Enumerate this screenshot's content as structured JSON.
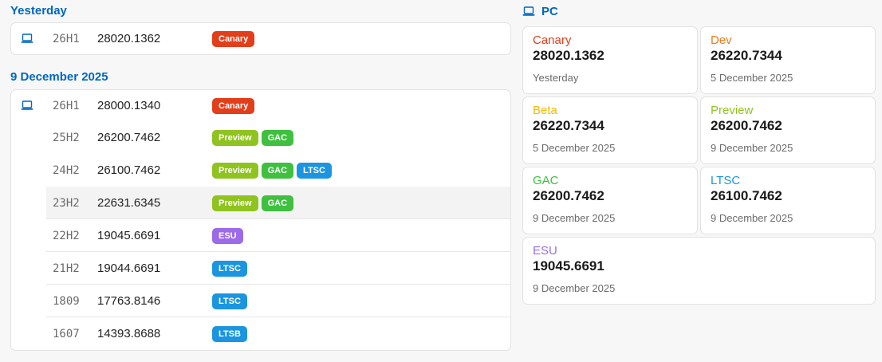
{
  "colors": {
    "accent": "#0067c0",
    "Canary": "#e23e1b",
    "Dev": "#ef7a1a",
    "Beta": "#f6b800",
    "Preview": "#8fc31f",
    "GAC": "#3fc03f",
    "LTSC": "#1b95e0",
    "LTSB": "#1b95e0",
    "ESU": "#9b6be8"
  },
  "feed": {
    "groups": [
      {
        "heading": "Yesterday",
        "rows": [
          {
            "icon": "laptop-icon",
            "version": "26H1",
            "build": "28020.1362",
            "badges": [
              "Canary"
            ]
          }
        ]
      },
      {
        "heading": "9 December 2025",
        "rows": [
          {
            "icon": "laptop-icon",
            "version": "26H1",
            "build": "28000.1340",
            "badges": [
              "Canary"
            ]
          },
          {
            "version": "25H2",
            "build": "26200.7462",
            "badges": [
              "Preview",
              "GAC"
            ]
          },
          {
            "version": "24H2",
            "build": "26100.7462",
            "badges": [
              "Preview",
              "GAC",
              "LTSC"
            ]
          },
          {
            "version": "23H2",
            "build": "22631.6345",
            "badges": [
              "Preview",
              "GAC"
            ],
            "highlight": true
          },
          {
            "version": "22H2",
            "build": "19045.6691",
            "badges": [
              "ESU"
            ]
          },
          {
            "version": "21H2",
            "build": "19044.6691",
            "badges": [
              "LTSC"
            ]
          },
          {
            "version": "1809",
            "build": "17763.8146",
            "badges": [
              "LTSC"
            ]
          },
          {
            "version": "1607",
            "build": "14393.8688",
            "badges": [
              "LTSB"
            ]
          }
        ]
      }
    ]
  },
  "pc": {
    "heading": "PC",
    "icon": "laptop-icon",
    "channels": [
      {
        "name": "Canary",
        "build": "28020.1362",
        "date": "Yesterday"
      },
      {
        "name": "Dev",
        "build": "26220.7344",
        "date": "5 December 2025"
      },
      {
        "name": "Beta",
        "build": "26220.7344",
        "date": "5 December 2025"
      },
      {
        "name": "Preview",
        "build": "26200.7462",
        "date": "9 December 2025"
      },
      {
        "name": "GAC",
        "build": "26200.7462",
        "date": "9 December 2025"
      },
      {
        "name": "LTSC",
        "build": "26100.7462",
        "date": "9 December 2025"
      },
      {
        "name": "ESU",
        "build": "19045.6691",
        "date": "9 December 2025"
      }
    ]
  }
}
